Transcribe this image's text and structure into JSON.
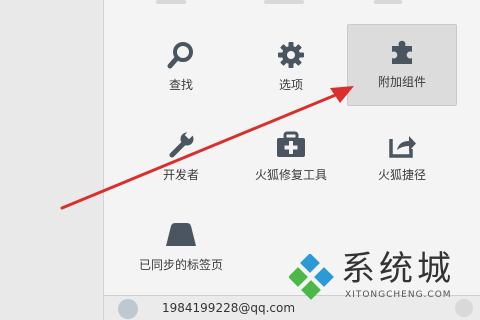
{
  "menu": {
    "items": [
      {
        "label": "查找",
        "icon": "search-icon"
      },
      {
        "label": "选项",
        "icon": "gear-icon"
      },
      {
        "label": "附加组件",
        "icon": "puzzle-icon",
        "highlighted": true
      },
      {
        "label": "开发者",
        "icon": "wrench-icon"
      },
      {
        "label": "火狐修复工具",
        "icon": "toolbox-icon"
      },
      {
        "label": "火狐捷径",
        "icon": "share-icon"
      },
      {
        "label": "已同步的标签页",
        "icon": "synced-tabs-icon"
      }
    ],
    "account": {
      "email": "1984199228@qq.com"
    }
  },
  "watermark": {
    "title": "系统城",
    "domain": "XITONGCHENG.COM"
  },
  "annotation": {
    "arrow_color": "#d9302c",
    "icon_color": "#4a5560"
  }
}
